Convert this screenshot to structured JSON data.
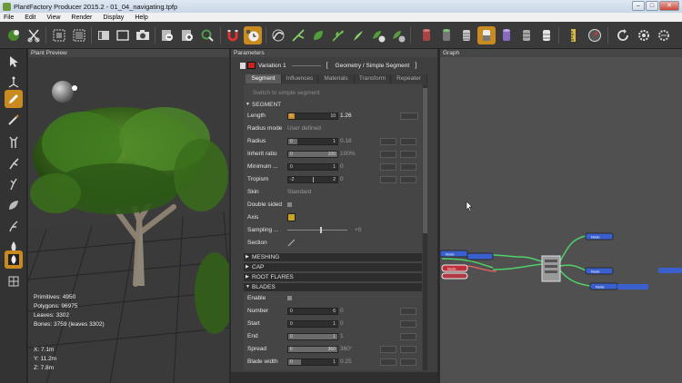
{
  "window": {
    "title": "PlantFactory Producer 2015.2 - 01_04_navigating.tpfp",
    "controls": [
      "–",
      "□",
      "✕"
    ]
  },
  "menu": [
    "File",
    "Edit",
    "View",
    "Render",
    "Display",
    "Help"
  ],
  "panels": {
    "preview": "Plant Preview",
    "parameters": "Parameters",
    "graph": "Graph"
  },
  "preview_stats": {
    "primitives": "Primitives: 4950",
    "polygons": "Polygons: 96975",
    "leaves": "Leaves: 3302",
    "bones": "Bones: 3759 (leaves 3302)",
    "x": "X: 7.1m",
    "y": "Y: 11.2m",
    "z": "Z: 7.8m"
  },
  "params": {
    "variation": "Variation 1",
    "bracket_open": "[",
    "node_type": "Geometry / Simple Segment",
    "bracket_close": "]",
    "tabs": [
      "Segment",
      "Influences",
      "Materials",
      "Transform",
      "Repeater"
    ],
    "switch_link": "Switch to simple segment",
    "sections": {
      "segment": "SEGMENT",
      "meshing": "MESHING",
      "cap": "CAP",
      "root_flares": "ROOT FLARES",
      "blades": "BLADES"
    },
    "segment_rows": {
      "length": {
        "label": "Length",
        "min": "0",
        "max": "10",
        "value": "1.26",
        "fill": 0.126
      },
      "radius_mode": {
        "label": "Radius mode",
        "value": "User defined"
      },
      "radius": {
        "label": "Radius",
        "min": "0",
        "max": "1",
        "value": "0.18",
        "fill": 0.18
      },
      "inherit_ratio": {
        "label": "Inherit ratio",
        "min": "0",
        "max": "100",
        "value": "100%",
        "fill": 1.0
      },
      "minimum": {
        "label": "Minimum ...",
        "min": "0",
        "max": "1",
        "value": "0",
        "fill": 0
      },
      "tropism": {
        "label": "Tropism",
        "min": "-2",
        "max": "2",
        "value": "0",
        "fill": 0.5
      },
      "skin": {
        "label": "Skin",
        "value": "Standard"
      },
      "double_sided": {
        "label": "Double sided"
      },
      "axis": {
        "label": "Axis"
      },
      "sampling": {
        "label": "Sampling ...",
        "value": "+0"
      },
      "section": {
        "label": "Section"
      }
    },
    "blades_rows": {
      "enable": {
        "label": "Enable"
      },
      "number": {
        "label": "Number",
        "min": "0",
        "max": "6",
        "value": "0",
        "fill": 0
      },
      "start": {
        "label": "Start",
        "min": "0",
        "max": "1",
        "value": "0",
        "fill": 0
      },
      "end": {
        "label": "End",
        "min": "0",
        "max": "1",
        "value": "1",
        "fill": 1.0
      },
      "spread": {
        "label": "Spread",
        "min": "0",
        "max": "360",
        "value": "360°",
        "fill": 1.0
      },
      "blade_width": {
        "label": "Blade width",
        "min": "0",
        "max": "1",
        "value": "0.25",
        "fill": 0.25
      }
    }
  },
  "graph_nodes": {
    "left_red": "Node",
    "left_top": "Node",
    "right_top": "Node",
    "right_mid": "Node",
    "right_bottom": "Node"
  },
  "colors": {
    "accent": "#c98a1f",
    "variation_swatch": "#cc2222",
    "wire_green": "#4fd06a",
    "node_blue": "#3a5fcf",
    "node_red": "#c0303a"
  }
}
